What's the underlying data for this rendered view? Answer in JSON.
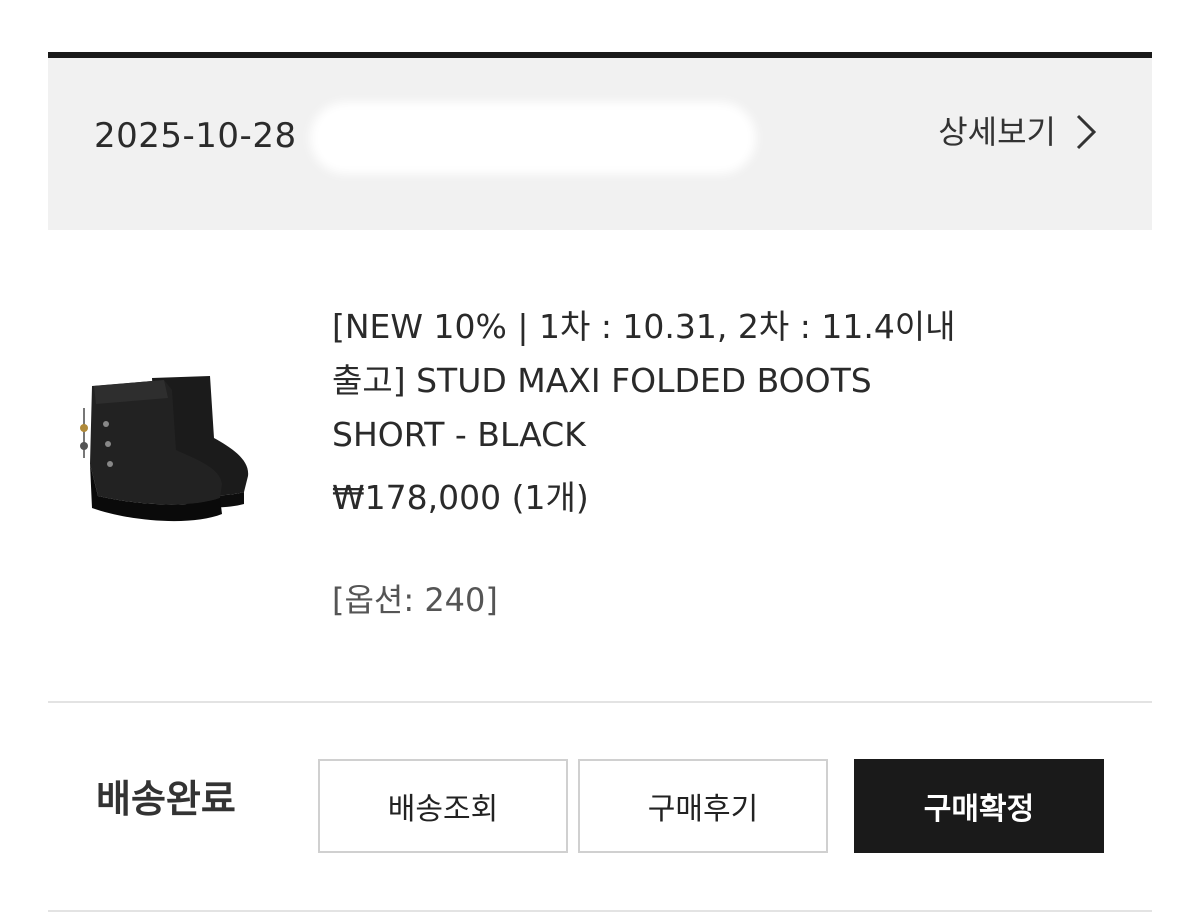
{
  "order": {
    "date": "2025-10-28",
    "detail_link_label": "상세보기"
  },
  "product": {
    "name_line1": "[NEW 10% | 1차 : 10.31, 2차 : 11.4이내",
    "name_line2": "출고] STUD MAXI FOLDED BOOTS",
    "name_line3": "SHORT - BLACK",
    "price": "₩178,000",
    "quantity": "(1개)",
    "option": "[옵션: 240]",
    "image_icon": "black-short-boots-image"
  },
  "status": {
    "label": "배송완료"
  },
  "actions": {
    "track_label": "배송조회",
    "review_label": "구매후기",
    "confirm_label": "구매확정"
  },
  "colors": {
    "accent_dark": "#1a1a1a",
    "header_bg": "#f1f1f1",
    "border": "#d0d0d0"
  }
}
